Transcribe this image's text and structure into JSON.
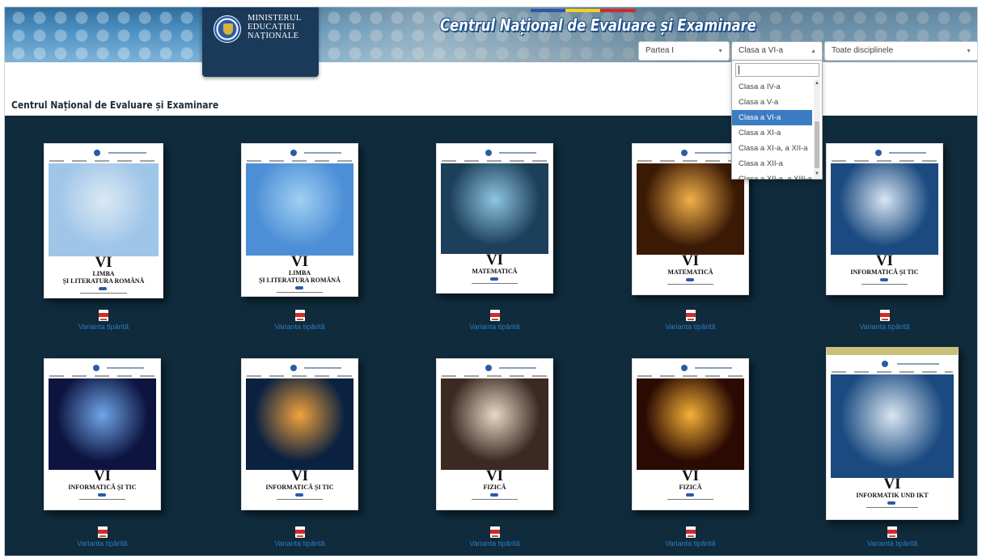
{
  "header": {
    "ministry_lines": [
      "MINISTERUL",
      "EDUCAȚIEI",
      "NAȚIONALE"
    ],
    "site_title": "Centrul Național de Evaluare și Examinare"
  },
  "filters": {
    "part": {
      "value": "Partea I"
    },
    "class": {
      "value": "Clasa a VI-a",
      "search_value": "",
      "options": [
        "Clasa a IV-a",
        "Clasa a V-a",
        "Clasa a VI-a",
        "Clasa a XI-a",
        "Clasa a XI-a, a XII-a",
        "Clasa a XII-a",
        "Clasa a XII-a, a XIII-a"
      ],
      "selected_index": 2
    },
    "discipline": {
      "value": "Toate disciplinele"
    }
  },
  "page_heading": "Centrul Național de Evaluare și Examinare",
  "books": [
    {
      "grade": "VI",
      "subject": [
        "LIMBA",
        "ȘI LITERATURA ROMÂNĂ"
      ],
      "link": "Varianta tipărită",
      "art": [
        "#9fc5e8",
        "#dbe9f5",
        "#6f9fd0"
      ]
    },
    {
      "grade": "VI",
      "subject": [
        "LIMBA",
        "ȘI LITERATURA ROMÂNĂ"
      ],
      "link": "Varianta tipărită",
      "art": [
        "#4d8fd6",
        "#9fd0f2",
        "#5a8f2a"
      ]
    },
    {
      "grade": "VI",
      "subject": [
        "MATEMATICĂ"
      ],
      "link": "Varianta tipărită",
      "art": [
        "#1c3f5a",
        "#8ec6e0",
        "#2a6f95"
      ]
    },
    {
      "grade": "VI",
      "subject": [
        "MATEMATICĂ"
      ],
      "link": "Varianta tipărită",
      "art": [
        "#3b1a05",
        "#f2b04a",
        "#7a3c0e"
      ]
    },
    {
      "grade": "VI",
      "subject": [
        "INFORMATICĂ ȘI TIC"
      ],
      "link": "Varianta tipărită",
      "art": [
        "#1a4a80",
        "#d9e6f2",
        "#c77a22"
      ]
    },
    {
      "grade": "VI",
      "subject": [
        "INFORMATICĂ ȘI TIC"
      ],
      "link": "Varianta tipărită",
      "art": [
        "#0d1440",
        "#6fa6e8",
        "#6b2ab0"
      ]
    },
    {
      "grade": "VI",
      "subject": [
        "INFORMATICĂ ȘI TIC"
      ],
      "link": "Varianta tipărită",
      "art": [
        "#0b2140",
        "#f2a23c",
        "#3a82c8"
      ]
    },
    {
      "grade": "VI",
      "subject": [
        "FIZICĂ"
      ],
      "link": "Varianta tipărită",
      "art": [
        "#3b2a22",
        "#e8d8c4",
        "#7a5a44"
      ]
    },
    {
      "grade": "VI",
      "subject": [
        "FIZICĂ"
      ],
      "link": "Varianta tipărită",
      "art": [
        "#2a0a02",
        "#f5b036",
        "#b33a0c"
      ]
    },
    {
      "grade": "VI",
      "subject": [
        "INFORMATIK UND IKT"
      ],
      "link": "Varianta tipărită",
      "art": [
        "#1a4a80",
        "#d9e6f2",
        "#c77a22"
      ]
    }
  ]
}
